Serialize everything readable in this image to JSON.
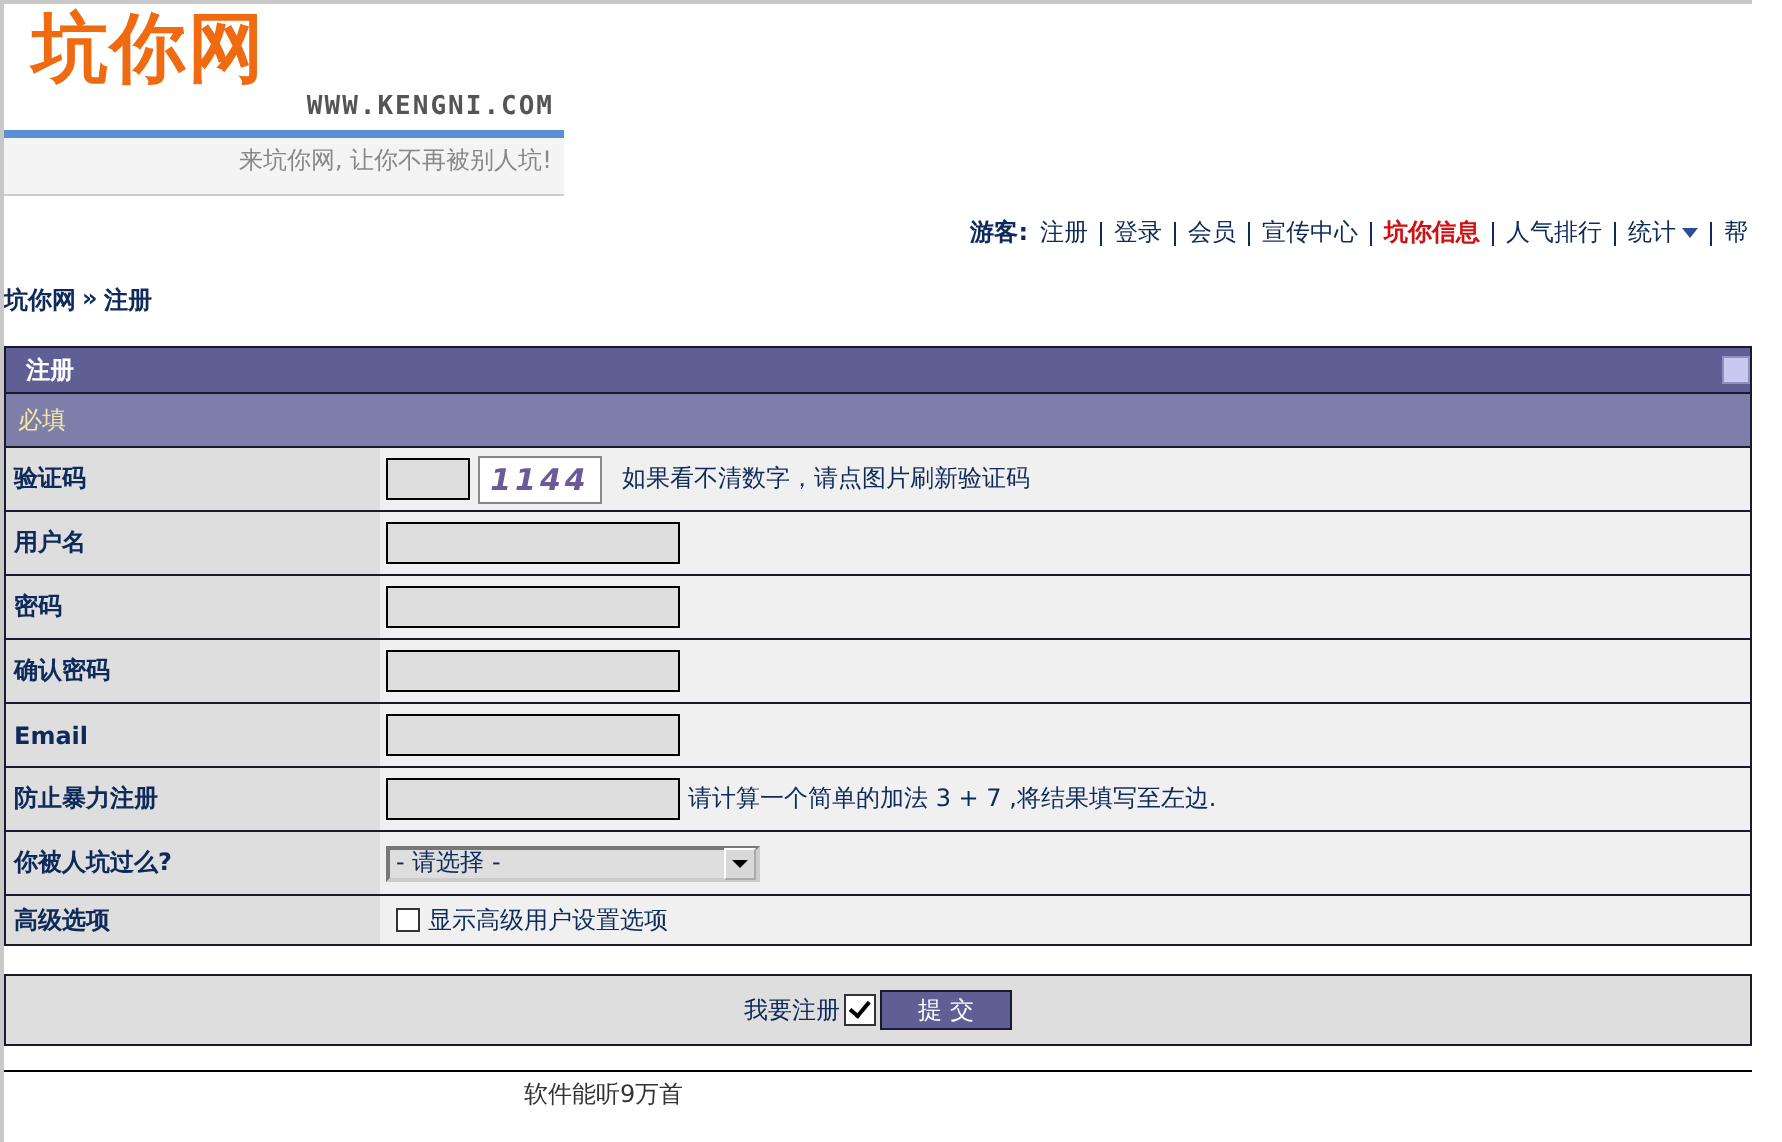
{
  "header": {
    "logo": "坑你网",
    "url": "WWW.KENGNI.COM",
    "slogan": "来坑你网, 让你不再被别人坑!"
  },
  "nav": {
    "label": "游客:",
    "items": [
      {
        "label": "注册",
        "highlighted": false,
        "dropdown": false
      },
      {
        "label": "登录",
        "highlighted": false,
        "dropdown": false
      },
      {
        "label": "会员",
        "highlighted": false,
        "dropdown": false
      },
      {
        "label": "宣传中心",
        "highlighted": false,
        "dropdown": false
      },
      {
        "label": "坑你信息",
        "highlighted": true,
        "dropdown": false
      },
      {
        "label": "人气排行",
        "highlighted": false,
        "dropdown": false
      },
      {
        "label": "统计",
        "highlighted": false,
        "dropdown": true
      },
      {
        "label": "帮",
        "highlighted": false,
        "dropdown": false
      }
    ]
  },
  "breadcrumb": {
    "home": "坑你网",
    "separator": "»",
    "current": "注册"
  },
  "form": {
    "title": "注册",
    "section": "必填",
    "rows": [
      {
        "kind": "captcha",
        "label": "验证码",
        "captcha": "1144",
        "hint": "如果看不清数字，请点图片刷新验证码"
      },
      {
        "kind": "text",
        "label": "用户名"
      },
      {
        "kind": "text",
        "label": "密码"
      },
      {
        "kind": "text",
        "label": "确认密码"
      },
      {
        "kind": "text",
        "label": "Email"
      },
      {
        "kind": "text",
        "label": "防止暴力注册",
        "hint": "请计算一个简单的加法 3 + 7 ,将结果填写至左边."
      },
      {
        "kind": "select",
        "label": "你被人坑过么?",
        "value": "- 请选择 -"
      },
      {
        "kind": "checkbox",
        "label": "高级选项",
        "option": "显示高级用户设置选项",
        "checked": false
      }
    ]
  },
  "submit": {
    "label": "我要注册",
    "checked": true,
    "button": "提 交"
  },
  "footer": {
    "fragment": "软件能听9万首"
  }
}
